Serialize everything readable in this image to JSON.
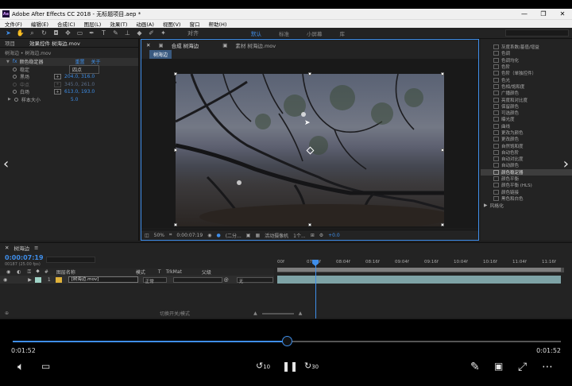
{
  "window": {
    "title": "Adobe After Effects CC 2018 - 无标题项目.aep *",
    "controls": [
      "—",
      "❐",
      "✕"
    ]
  },
  "menu": [
    "文件(F)",
    "编辑(E)",
    "合成(C)",
    "图层(L)",
    "效果(T)",
    "动画(A)",
    "视图(V)",
    "窗口",
    "帮助(H)"
  ],
  "toolbar": {
    "align_label": "对齐",
    "workspaces": [
      "默认",
      "标准",
      "小屏幕",
      "库"
    ],
    "active_ws": "默认",
    "search_placeholder": "搜索帮助"
  },
  "project_panel": {
    "tab_project": "项目",
    "tab_effects": "效果控件 树海边.mov",
    "subtitle": "树海边 • 树海边.mov",
    "effect_name": "颜色稳定器",
    "reset": "重置",
    "about": "关于",
    "rows": [
      {
        "name": "稳定",
        "value": "四点"
      },
      {
        "name": "黑场",
        "value": "204.0, 316.0"
      },
      {
        "name": "中点",
        "value": "345.0, 261.0"
      },
      {
        "name": "白场",
        "value": "613.0, 193.0"
      },
      {
        "name": "样本大小",
        "value": "5.0"
      }
    ]
  },
  "composition": {
    "tab_comp": "合成 树海边",
    "tab_footage": "素材 树海边.mov",
    "chip": "树海边",
    "controls": {
      "zoom": "50%",
      "timecode": "0:00:07:19",
      "quality": "(二分...",
      "camera": "活动摄像机",
      "views": "1个...",
      "offset": "+0.0"
    }
  },
  "effects_list": {
    "items": [
      "灰度系数/基值/增益",
      "色调",
      "色调均化",
      "色阶",
      "色阶（单独控件）",
      "色光",
      "色相/饱和度",
      "广播颜色",
      "亮度和对比度",
      "保留颜色",
      "可选颜色",
      "曝光度",
      "曲线",
      "更改为颜色",
      "更改颜色",
      "自然饱和度",
      "自动色阶",
      "自动对比度",
      "自动颜色",
      "颜色稳定器",
      "颜色平衡",
      "颜色平衡 (HLS)",
      "颜色链接",
      "黑色和白色"
    ],
    "selected": "颜色稳定器",
    "group": "风格化"
  },
  "timeline": {
    "tab": "树海边",
    "timecode": "0:00:07:19",
    "frame_info": "00187 (25.00 fps)",
    "columns": {
      "num": "#",
      "layer_name": "图层名称",
      "mode": "模式",
      "t": "T",
      "trkmat": "TrkMat",
      "parent": "父级"
    },
    "layer": {
      "index": "1",
      "name": "[树海边.mov]",
      "mode": "正常",
      "parent": "无"
    },
    "ticks": [
      "00f",
      "07:16f",
      "08:04f",
      "08:16f",
      "09:04f",
      "09:16f",
      "10:04f",
      "10:16f",
      "11:04f",
      "11:16f"
    ],
    "footer": "切换开关/模式"
  },
  "player": {
    "current": "0:01:52",
    "total": "0:01:52",
    "progress": 0.5,
    "rewind": "10",
    "forward": "30"
  }
}
